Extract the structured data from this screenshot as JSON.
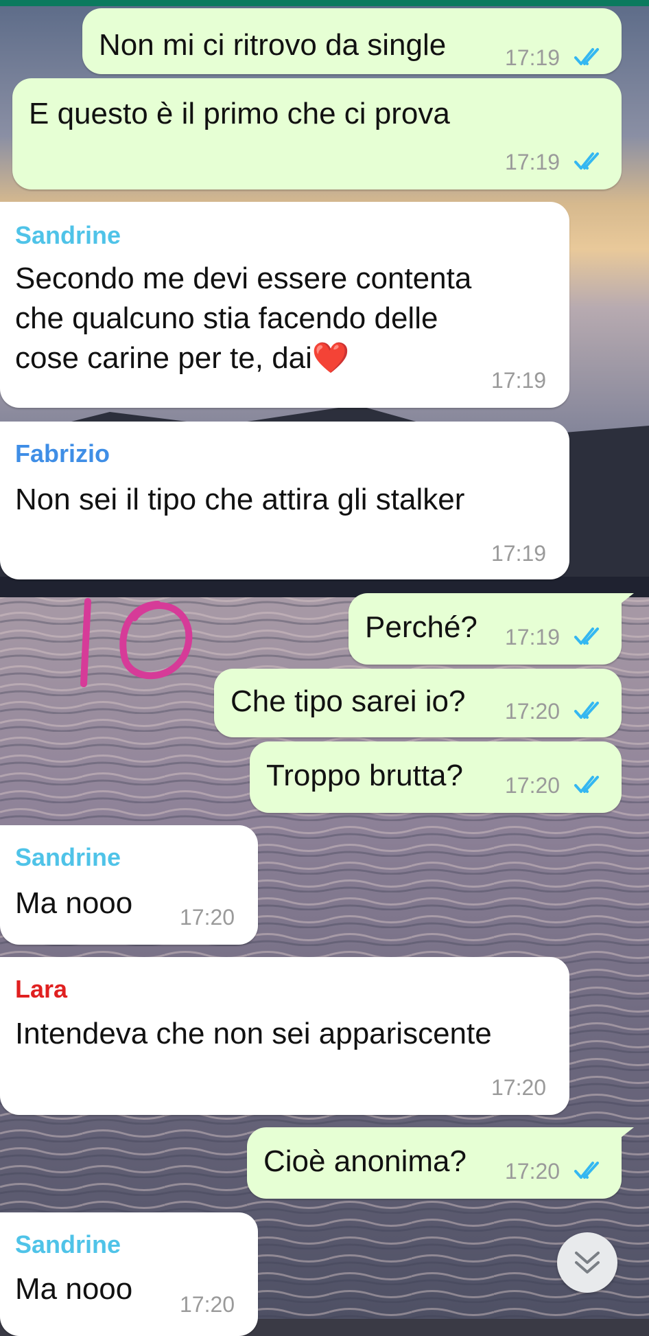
{
  "colors": {
    "outgoing_bubble": "#e6ffd4",
    "incoming_bubble": "#ffffff",
    "read_ticks": "#34b7f1",
    "sandrine": "#4fc3e8",
    "fabrizio": "#3f8ee6",
    "lara": "#e02020",
    "scribble": "#d63b98"
  },
  "messages": [
    {
      "dir": "out",
      "text": "Non mi ci ritrovo da single",
      "time": "17:19",
      "status": "read"
    },
    {
      "dir": "out",
      "text": "E questo è il primo che ci prova",
      "time": "17:19",
      "status": "read"
    },
    {
      "dir": "in",
      "sender": "Sandrine",
      "lines": [
        "Secondo me devi essere contenta",
        "che qualcuno stia facendo delle",
        "cose carine per te, dai"
      ],
      "emoji": "❤️",
      "time": "17:19"
    },
    {
      "dir": "in",
      "sender": "Fabrizio",
      "text": "Non sei il tipo che attira gli stalker",
      "time": "17:19"
    },
    {
      "dir": "out",
      "text": "Perché?",
      "time": "17:19",
      "status": "read"
    },
    {
      "dir": "out",
      "text": "Che tipo sarei io?",
      "time": "17:20",
      "status": "read"
    },
    {
      "dir": "out",
      "text": "Troppo brutta?",
      "time": "17:20",
      "status": "read"
    },
    {
      "dir": "in",
      "sender": "Sandrine",
      "text": "Ma nooo",
      "time": "17:20"
    },
    {
      "dir": "in",
      "sender": "Lara",
      "text": "Intendeva che non sei appariscente",
      "time": "17:20"
    },
    {
      "dir": "out",
      "text": "Cioè anonima?",
      "time": "17:20",
      "status": "read"
    },
    {
      "dir": "in",
      "sender": "Sandrine",
      "text": "Ma nooo",
      "time": "17:20"
    }
  ],
  "annotation": {
    "icon": "hand-drawn-io-scribble"
  },
  "scroll_button": {
    "icon": "double-chevron-down-icon"
  }
}
